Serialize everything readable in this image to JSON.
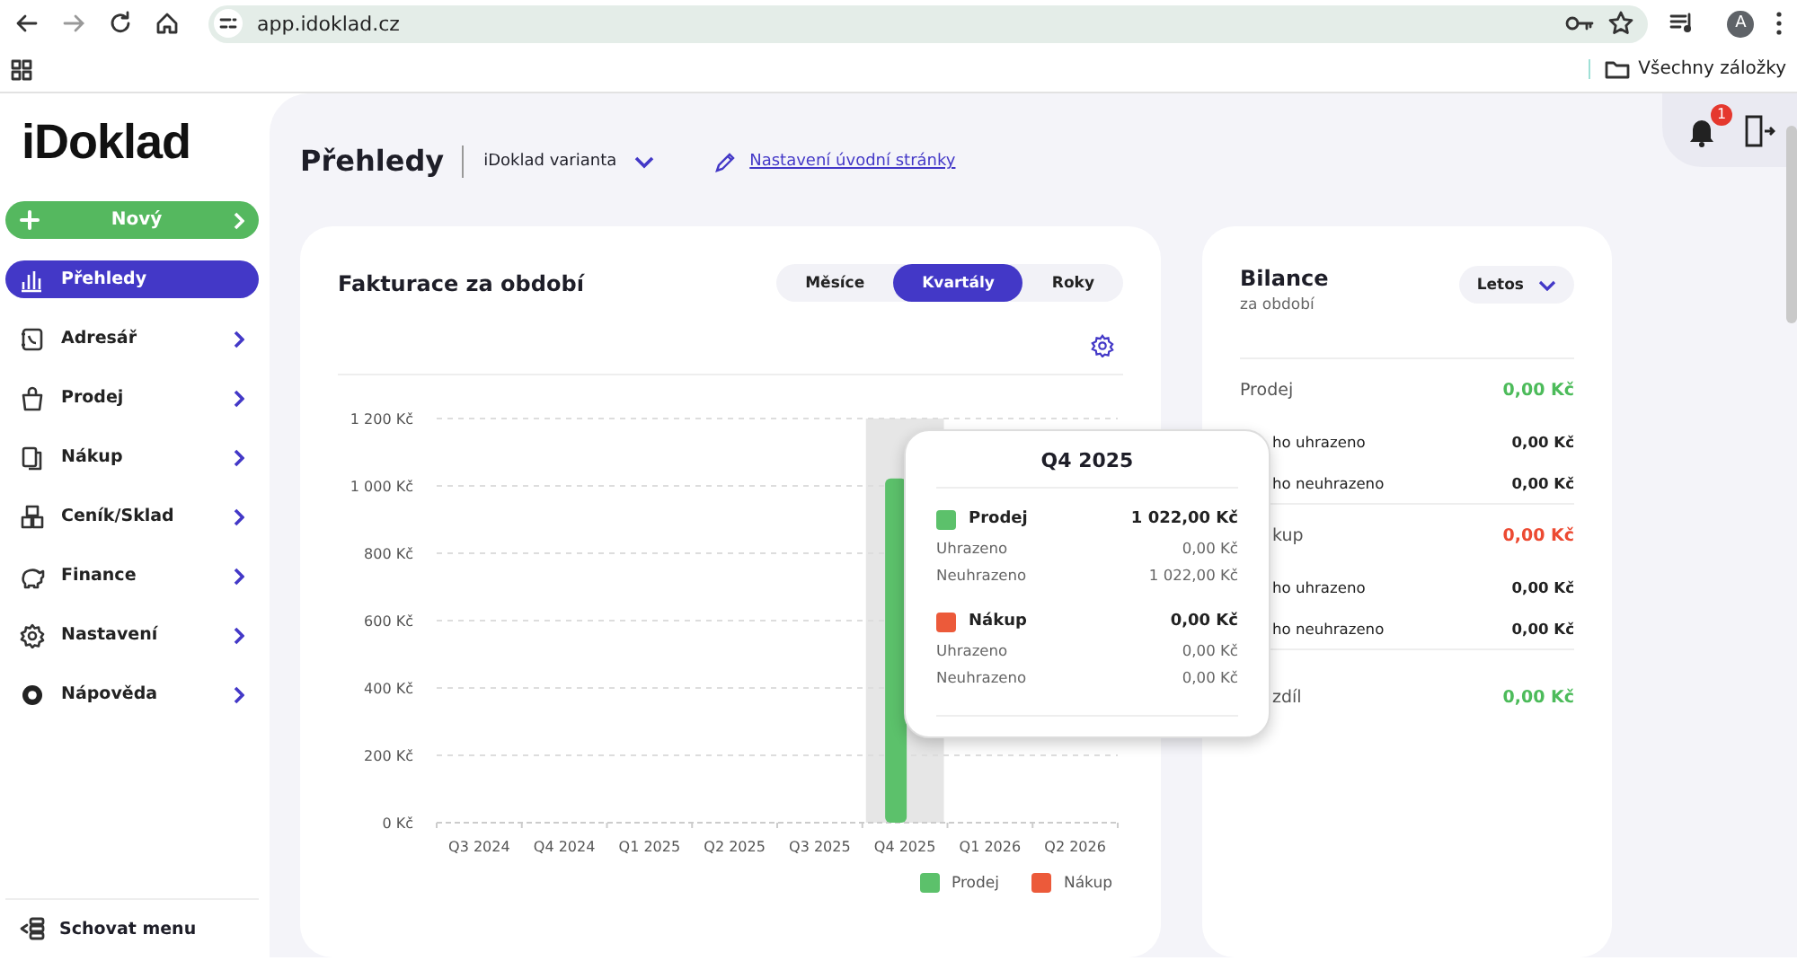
{
  "browser": {
    "url": "app.idoklad.cz",
    "profile_initial": "A",
    "bookmarks_folder": "Všechny záložky"
  },
  "sidebar": {
    "logo": "iDoklad",
    "new_button": "Nový",
    "items": [
      {
        "label": "Přehledy",
        "kind": "chart",
        "selected": true,
        "expandable": false
      },
      {
        "label": "Adresář",
        "kind": "contacts",
        "selected": false,
        "expandable": true
      },
      {
        "label": "Prodej",
        "kind": "bag",
        "selected": false,
        "expandable": true
      },
      {
        "label": "Nákup",
        "kind": "docs",
        "selected": false,
        "expandable": true
      },
      {
        "label": "Ceník/Sklad",
        "kind": "boxes",
        "selected": false,
        "expandable": true
      },
      {
        "label": "Finance",
        "kind": "piggy",
        "selected": false,
        "expandable": true
      },
      {
        "label": "Nastavení",
        "kind": "gear",
        "selected": false,
        "expandable": true
      },
      {
        "label": "Nápověda",
        "kind": "lifebuoy",
        "selected": false,
        "expandable": true
      }
    ],
    "footer": "Schovat menu"
  },
  "header": {
    "title": "Přehledy",
    "variant": "iDoklad varianta",
    "settings_link": "Nastavení úvodní stránky",
    "notification_count": "1"
  },
  "invoicing": {
    "title": "Fakturace za období",
    "tabs": [
      {
        "label": "Měsíce",
        "selected": false
      },
      {
        "label": "Kvartály",
        "selected": true
      },
      {
        "label": "Roky",
        "selected": false
      }
    ],
    "chart_data": {
      "type": "bar",
      "categories": [
        "Q3 2024",
        "Q4 2024",
        "Q1 2025",
        "Q2 2025",
        "Q3 2025",
        "Q4 2025",
        "Q1 2026",
        "Q2 2026"
      ],
      "series": [
        {
          "name": "Prodej",
          "color": "#5cc16b",
          "values": [
            0,
            0,
            0,
            0,
            0,
            1022,
            0,
            0
          ]
        },
        {
          "name": "Nákup",
          "color": "#ec5a3a",
          "values": [
            0,
            0,
            0,
            0,
            0,
            0,
            0,
            0
          ]
        }
      ],
      "ylim": [
        0,
        1200
      ],
      "yticks": [
        {
          "value": 0,
          "label": "0 Kč"
        },
        {
          "value": 200,
          "label": "200 Kč"
        },
        {
          "value": 400,
          "label": "400 Kč"
        },
        {
          "value": 600,
          "label": "600 Kč"
        },
        {
          "value": 800,
          "label": "800 Kč"
        },
        {
          "value": 1000,
          "label": "1 000 Kč"
        },
        {
          "value": 1200,
          "label": "1 200 Kč"
        }
      ],
      "grid": true
    },
    "tooltip": {
      "title": "Q4 2025",
      "groups": [
        {
          "name": "Prodej",
          "color": "#5cc16b",
          "total": "1 022,00 Kč",
          "rows": [
            {
              "label": "Uhrazeno",
              "value": "0,00 Kč"
            },
            {
              "label": "Neuhrazeno",
              "value": "1 022,00 Kč"
            }
          ]
        },
        {
          "name": "Nákup",
          "color": "#ec5a3a",
          "total": "0,00 Kč",
          "rows": [
            {
              "label": "Uhrazeno",
              "value": "0,00 Kč"
            },
            {
              "label": "Neuhrazeno",
              "value": "0,00 Kč"
            }
          ]
        }
      ]
    }
  },
  "balance": {
    "title": "Bilance",
    "subtitle": "za období",
    "period": "Letos",
    "rows": [
      {
        "kind": "total",
        "label": "Prodej",
        "value": "0,00 Kč",
        "color": "#4cbb5a",
        "covered": false
      },
      {
        "kind": "detail",
        "label": "ho uhrazeno",
        "value": "0,00 Kč",
        "covered": true
      },
      {
        "kind": "detail",
        "label": "ho neuhrazeno",
        "value": "0,00 Kč",
        "covered": true
      },
      {
        "kind": "total",
        "label": "kup",
        "value": "0,00 Kč",
        "color": "#ec4a32",
        "covered": true
      },
      {
        "kind": "detail",
        "label": "ho uhrazeno",
        "value": "0,00 Kč",
        "covered": true
      },
      {
        "kind": "detail",
        "label": "ho neuhrazeno",
        "value": "0,00 Kč",
        "covered": true
      },
      {
        "kind": "result",
        "label": "zdíl",
        "value": "0,00 Kč",
        "color": "#4cbb5a",
        "covered": true
      }
    ]
  }
}
